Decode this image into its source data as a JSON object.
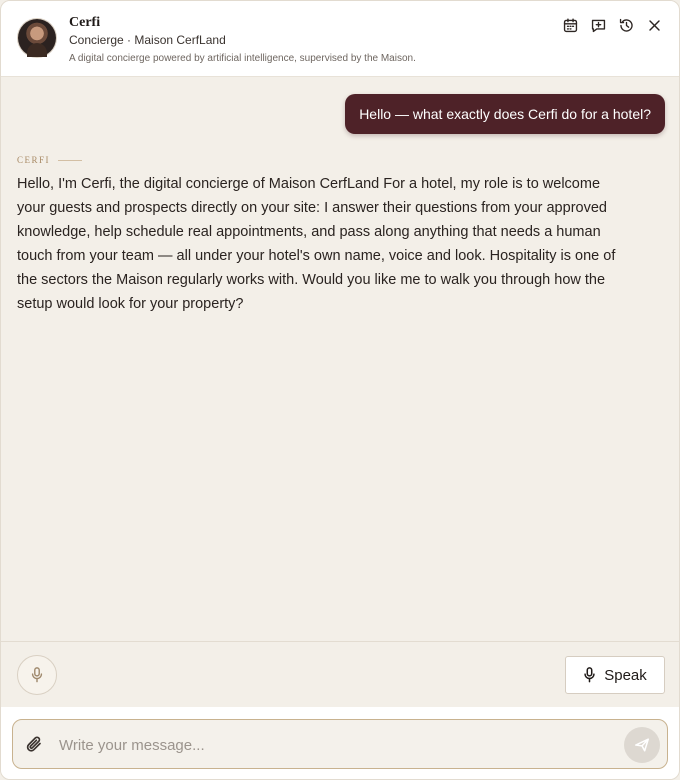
{
  "header": {
    "name": "Cerfi",
    "subtitle": "Concierge · Maison CerfLand",
    "disclaimer": "A digital concierge powered by artificial intelligence, supervised by the Maison.",
    "icons": [
      "calendar-icon",
      "new-chat-icon",
      "history-icon",
      "close-icon"
    ]
  },
  "conversation": {
    "user_message": "Hello — what exactly does Cerfi do for a hotel?",
    "bot_label": "CERFI",
    "bot_message": "Hello, I'm Cerfi, the digital concierge of Maison CerfLand For a hotel, my role is to welcome your guests and prospects directly on your site: I answer their questions from your approved knowledge, help schedule real appointments, and pass along anything that needs a human touch from your team — all under your hotel's own name, voice and look. Hospitality is one of the sectors the Maison regularly works with. Would you like me to walk you through how the setup would look for your property?"
  },
  "controls": {
    "mic_icon": "mic-icon",
    "speak_label": "Speak"
  },
  "composer": {
    "placeholder": "Write your message...",
    "value": "",
    "attach_icon": "paperclip-icon",
    "send_icon": "send-icon"
  },
  "colors": {
    "accent_burgundy": "#4e2228",
    "background_cream": "#f3efe8",
    "label_gold": "#a88a65",
    "composer_border": "#c8b28f"
  }
}
